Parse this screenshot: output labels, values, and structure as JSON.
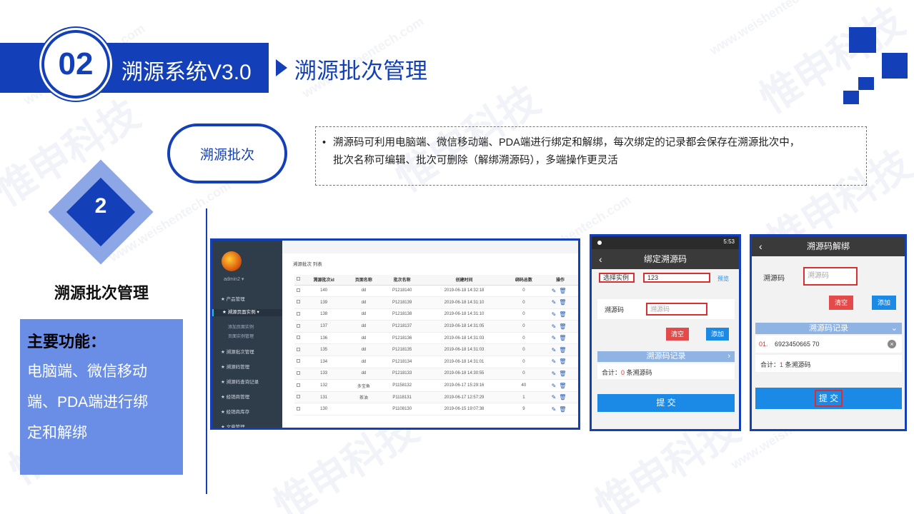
{
  "watermark": "惟申科技",
  "watermark_url": "www.weishentech.com",
  "header": {
    "number": "02",
    "system_title": "溯源系统V3.0",
    "section_title": "溯源批次管理"
  },
  "pill_label": "溯源批次",
  "description": {
    "bullet": "•",
    "line1": "溯源码可利用电脑端、微信移动端、PDA端进行绑定和解绑，每次绑定的记录都会保存在溯源批次中，",
    "line2": "批次名称可编辑、批次可删除（解绑溯源码），多端操作更灵活"
  },
  "diamond_number": "2",
  "left_title": "溯源批次管理",
  "features": {
    "title": "主要功能：",
    "lines": [
      "电脑端、微信移动",
      "端、PDA端进行绑",
      "定和解绑"
    ]
  },
  "admin": {
    "user": "admin2 ▾",
    "menu": [
      "产品管理",
      "溯源页面实例",
      "溯源批次管理",
      "溯源码管理",
      "溯源码查询记录",
      "经销商管理",
      "经销商库存",
      "文章管理"
    ],
    "submenu": [
      "添加页面实例",
      "页面实例管理"
    ],
    "breadcrumb": "溯源批次 列表",
    "columns": [
      "溯源批次id",
      "页面名称",
      "批次名称",
      "创建时间",
      "绑码总数",
      "操作"
    ],
    "rows": [
      [
        "140",
        "dd",
        "P1218140",
        "2019-06-18 14:32:18",
        "0"
      ],
      [
        "139",
        "dd",
        "P1218139",
        "2019-06-18 14:31:10",
        "0"
      ],
      [
        "138",
        "dd",
        "P1218138",
        "2019-06-18 14:31:10",
        "0"
      ],
      [
        "137",
        "dd",
        "P1218137",
        "2019-06-18 14:31:05",
        "0"
      ],
      [
        "136",
        "dd",
        "P1218136",
        "2019-06-18 14:31:03",
        "0"
      ],
      [
        "135",
        "dd",
        "P1218135",
        "2019-06-18 14:31:03",
        "0"
      ],
      [
        "134",
        "dd",
        "P1218134",
        "2019-06-18 14:31:01",
        "0"
      ],
      [
        "133",
        "dd",
        "P1218133",
        "2019-06-18 14:30:55",
        "0"
      ],
      [
        "132",
        "多宝鱼",
        "P1158132",
        "2019-06-17 15:29:16",
        "40"
      ],
      [
        "131",
        "茶油",
        "P1118131",
        "2019-06-17 12:57:29",
        "1"
      ],
      [
        "130",
        "",
        "P1108130",
        "2019-06-15 19:07:38",
        "9"
      ]
    ]
  },
  "phone_bind": {
    "time": "5:53",
    "title": "绑定溯源码",
    "select_label": "选择实例",
    "select_value": "123",
    "preview": "预览",
    "code_label": "溯源码",
    "code_placeholder": "溯源码",
    "clear": "清空",
    "add": "添加",
    "record_bar": "溯源码记录",
    "total_prefix": "合计：",
    "total_count": "0",
    "total_suffix": "条溯源码",
    "submit": "提 交"
  },
  "phone_unbind": {
    "title": "溯源码解绑",
    "code_label": "溯源码",
    "code_placeholder": "溯源码",
    "clear": "清空",
    "add": "添加",
    "record_bar": "溯源码记录",
    "item_index": "01.",
    "item_code": "6923450665 70",
    "total_prefix": "合计：",
    "total_count": "1",
    "total_suffix": "条溯源码",
    "submit": "提 交"
  },
  "colors": {
    "primary": "#1340b8",
    "light": "#6a8de6",
    "red": "#d63030"
  }
}
